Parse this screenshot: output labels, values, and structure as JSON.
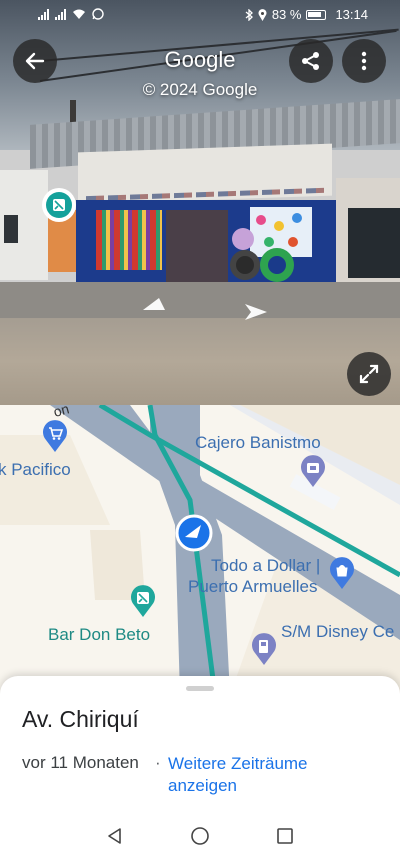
{
  "status_bar": {
    "battery_percent": "83 %",
    "time": "13:14",
    "icons": [
      "signal-icon",
      "signal-icon",
      "wifi-icon",
      "whatsapp-icon",
      "bluetooth-icon",
      "location-icon",
      "battery-icon"
    ]
  },
  "street_view": {
    "title": "Google",
    "copyright": "© 2024 Google",
    "buttons": {
      "back": "back-arrow-icon",
      "share": "share-icon",
      "more": "more-vert-icon",
      "expand": "expand-icon"
    }
  },
  "map": {
    "labels": {
      "pacifico": "k Pacifico",
      "cajero": "Cajero Banistmo",
      "dollar_line1": "Todo a Dollar |",
      "dollar_line2": "Puerto Armuelles",
      "bar": "Bar Don Beto",
      "disney": "S/M Disney Ce"
    },
    "colors": {
      "road": "#9aa9bd",
      "transit": "#1fa79c",
      "background": "#f8f5ee",
      "label_blue": "#3c6fb0",
      "label_teal": "#1e8a84"
    }
  },
  "sheet": {
    "title": "Av. Chiriquí",
    "time": "vor 11 Monaten",
    "separator": "·",
    "more_periods": "Weitere Zeiträume anzeigen"
  },
  "navbar": {
    "icons": [
      "back-triangle-icon",
      "home-circle-icon",
      "recents-square-icon"
    ]
  }
}
